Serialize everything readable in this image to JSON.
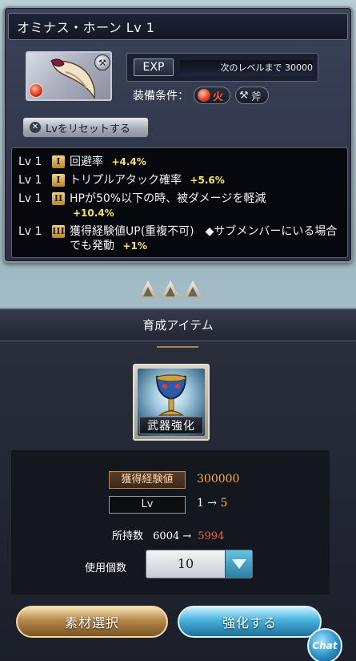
{
  "weapon": {
    "title": "オミナス・ホーン Lv 1",
    "exp_label": "EXP",
    "exp_next": "次のレベルまで 30000",
    "equip_label": "装備条件：",
    "element": "火",
    "weapon_type": "斧",
    "reset_label": "Lvをリセットする"
  },
  "skills": [
    {
      "lv": "Lv 1",
      "tier": "I",
      "text": "回避率",
      "value": "+4.4%"
    },
    {
      "lv": "Lv 1",
      "tier": "I",
      "text": "トリプルアタック確率",
      "value": "+5.6%"
    },
    {
      "lv": "Lv 1",
      "tier": "II",
      "text": "HPが50%以下の時、被ダメージを軽減",
      "value": "+10.4%"
    },
    {
      "lv": "Lv 1",
      "tier": "III",
      "text": "獲得経験値UP(重複不可)　◆サブメンバーにいる場合でも発動",
      "value": "+1%"
    }
  ],
  "upgrade": {
    "section_title": "育成アイテム",
    "item_label": "武器強化",
    "exp_tag": "獲得経験値",
    "exp_value": "300000",
    "lv_tag": "Lv",
    "lv_from": "1 →",
    "lv_to": "5",
    "owned_label": "所持数",
    "owned_before": "6004 →",
    "owned_after": "5994",
    "use_label": "使用個数",
    "use_value": "10",
    "material_button": "素材選択",
    "upgrade_button": "強化する",
    "chat_label": "Chat"
  },
  "colors": {
    "fire": "#e23a1c",
    "highlight": "#f7e36b",
    "orange": "#ffae3a"
  }
}
